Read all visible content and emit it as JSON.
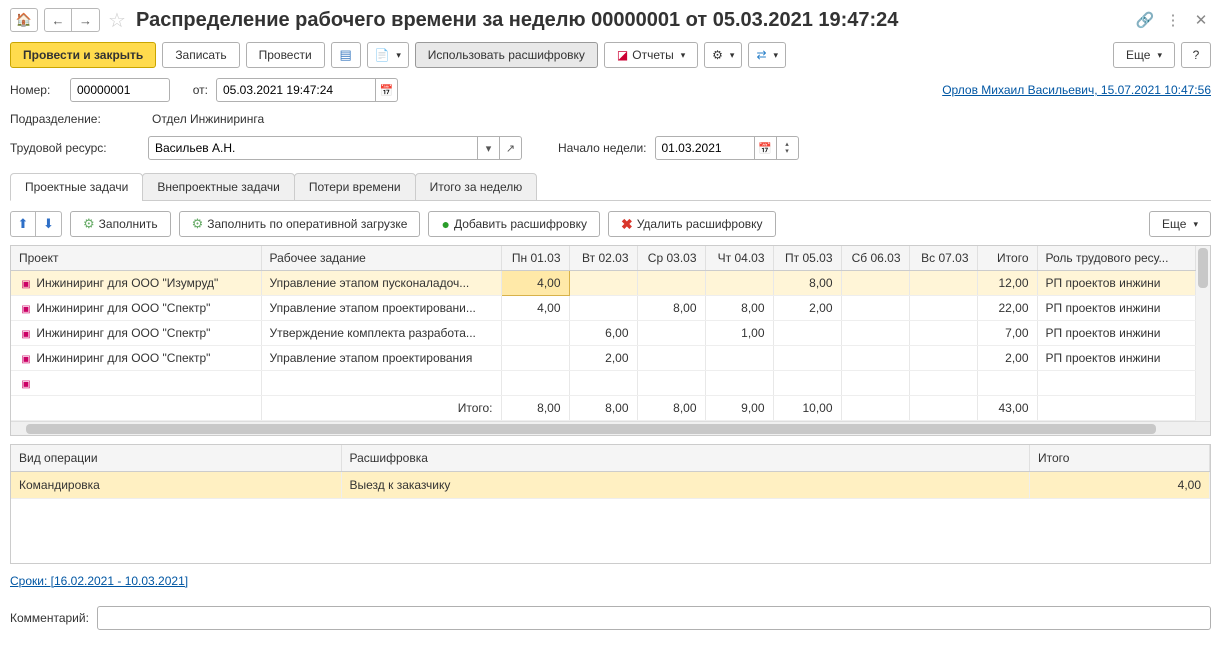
{
  "header": {
    "title": "Распределение рабочего времени за неделю 00000001 от 05.03.2021 19:47:24"
  },
  "toolbar": {
    "post_close": "Провести и закрыть",
    "save": "Записать",
    "post": "Провести",
    "use_decode": "Использовать расшифровку",
    "reports": "Отчеты",
    "more": "Еще",
    "help": "?"
  },
  "form": {
    "number_label": "Номер:",
    "number": "00000001",
    "from_label": "от:",
    "date": "05.03.2021 19:47:24",
    "department_label": "Подразделение:",
    "department": "Отдел Инжиниринга",
    "resource_label": "Трудовой ресурс:",
    "resource": "Васильев А.Н.",
    "week_start_label": "Начало недели:",
    "week_start": "01.03.2021",
    "user_link": "Орлов Михаил Васильевич, 15.07.2021 10:47:56"
  },
  "tabs": {
    "items": [
      "Проектные задачи",
      "Внепроектные задачи",
      "Потери времени",
      "Итого за неделю"
    ],
    "active_index": 0
  },
  "tab_toolbar": {
    "fill": "Заполнить",
    "fill_by_load": "Заполнить по оперативной загрузке",
    "add_decode": "Добавить расшифровку",
    "del_decode": "Удалить расшифровку",
    "more": "Еще"
  },
  "grid": {
    "columns": [
      "Проект",
      "Рабочее задание",
      "Пн 01.03",
      "Вт 02.03",
      "Ср 03.03",
      "Чт 04.03",
      "Пт 05.03",
      "Сб 06.03",
      "Вс 07.03",
      "Итого",
      "Роль трудового ресу..."
    ],
    "rows": [
      {
        "project": "Инжиниринг для ООО \"Изумруд\"",
        "task": "Управление этапом пусконаладоч...",
        "d": [
          "4,00",
          "",
          "",
          "",
          "8,00",
          "",
          "",
          "12,00"
        ],
        "role": "РП проектов инжини"
      },
      {
        "project": "Инжиниринг для ООО \"Спектр\"",
        "task": "Управление этапом проектировани...",
        "d": [
          "4,00",
          "",
          "8,00",
          "8,00",
          "2,00",
          "",
          "",
          "22,00"
        ],
        "role": "РП проектов инжини"
      },
      {
        "project": "Инжиниринг для ООО \"Спектр\"",
        "task": "Утверждение комплекта разработа...",
        "d": [
          "",
          "6,00",
          "",
          "1,00",
          "",
          "",
          "",
          "7,00"
        ],
        "role": "РП проектов инжини"
      },
      {
        "project": "Инжиниринг для ООО \"Спектр\"",
        "task": "Управление этапом проектирования",
        "d": [
          "",
          "2,00",
          "",
          "",
          "",
          "",
          "",
          "2,00"
        ],
        "role": "РП проектов инжини"
      }
    ],
    "footer_label": "Итого:",
    "footer": [
      "8,00",
      "8,00",
      "8,00",
      "9,00",
      "10,00",
      "",
      "",
      "43,00"
    ]
  },
  "detail": {
    "columns": [
      "Вид операции",
      "Расшифровка",
      "Итого"
    ],
    "rows": [
      {
        "op": "Командировка",
        "desc": "Выезд к заказчику",
        "total": "4,00"
      }
    ]
  },
  "terms": "Сроки: [16.02.2021 - 10.03.2021]",
  "comment_label": "Комментарий:"
}
